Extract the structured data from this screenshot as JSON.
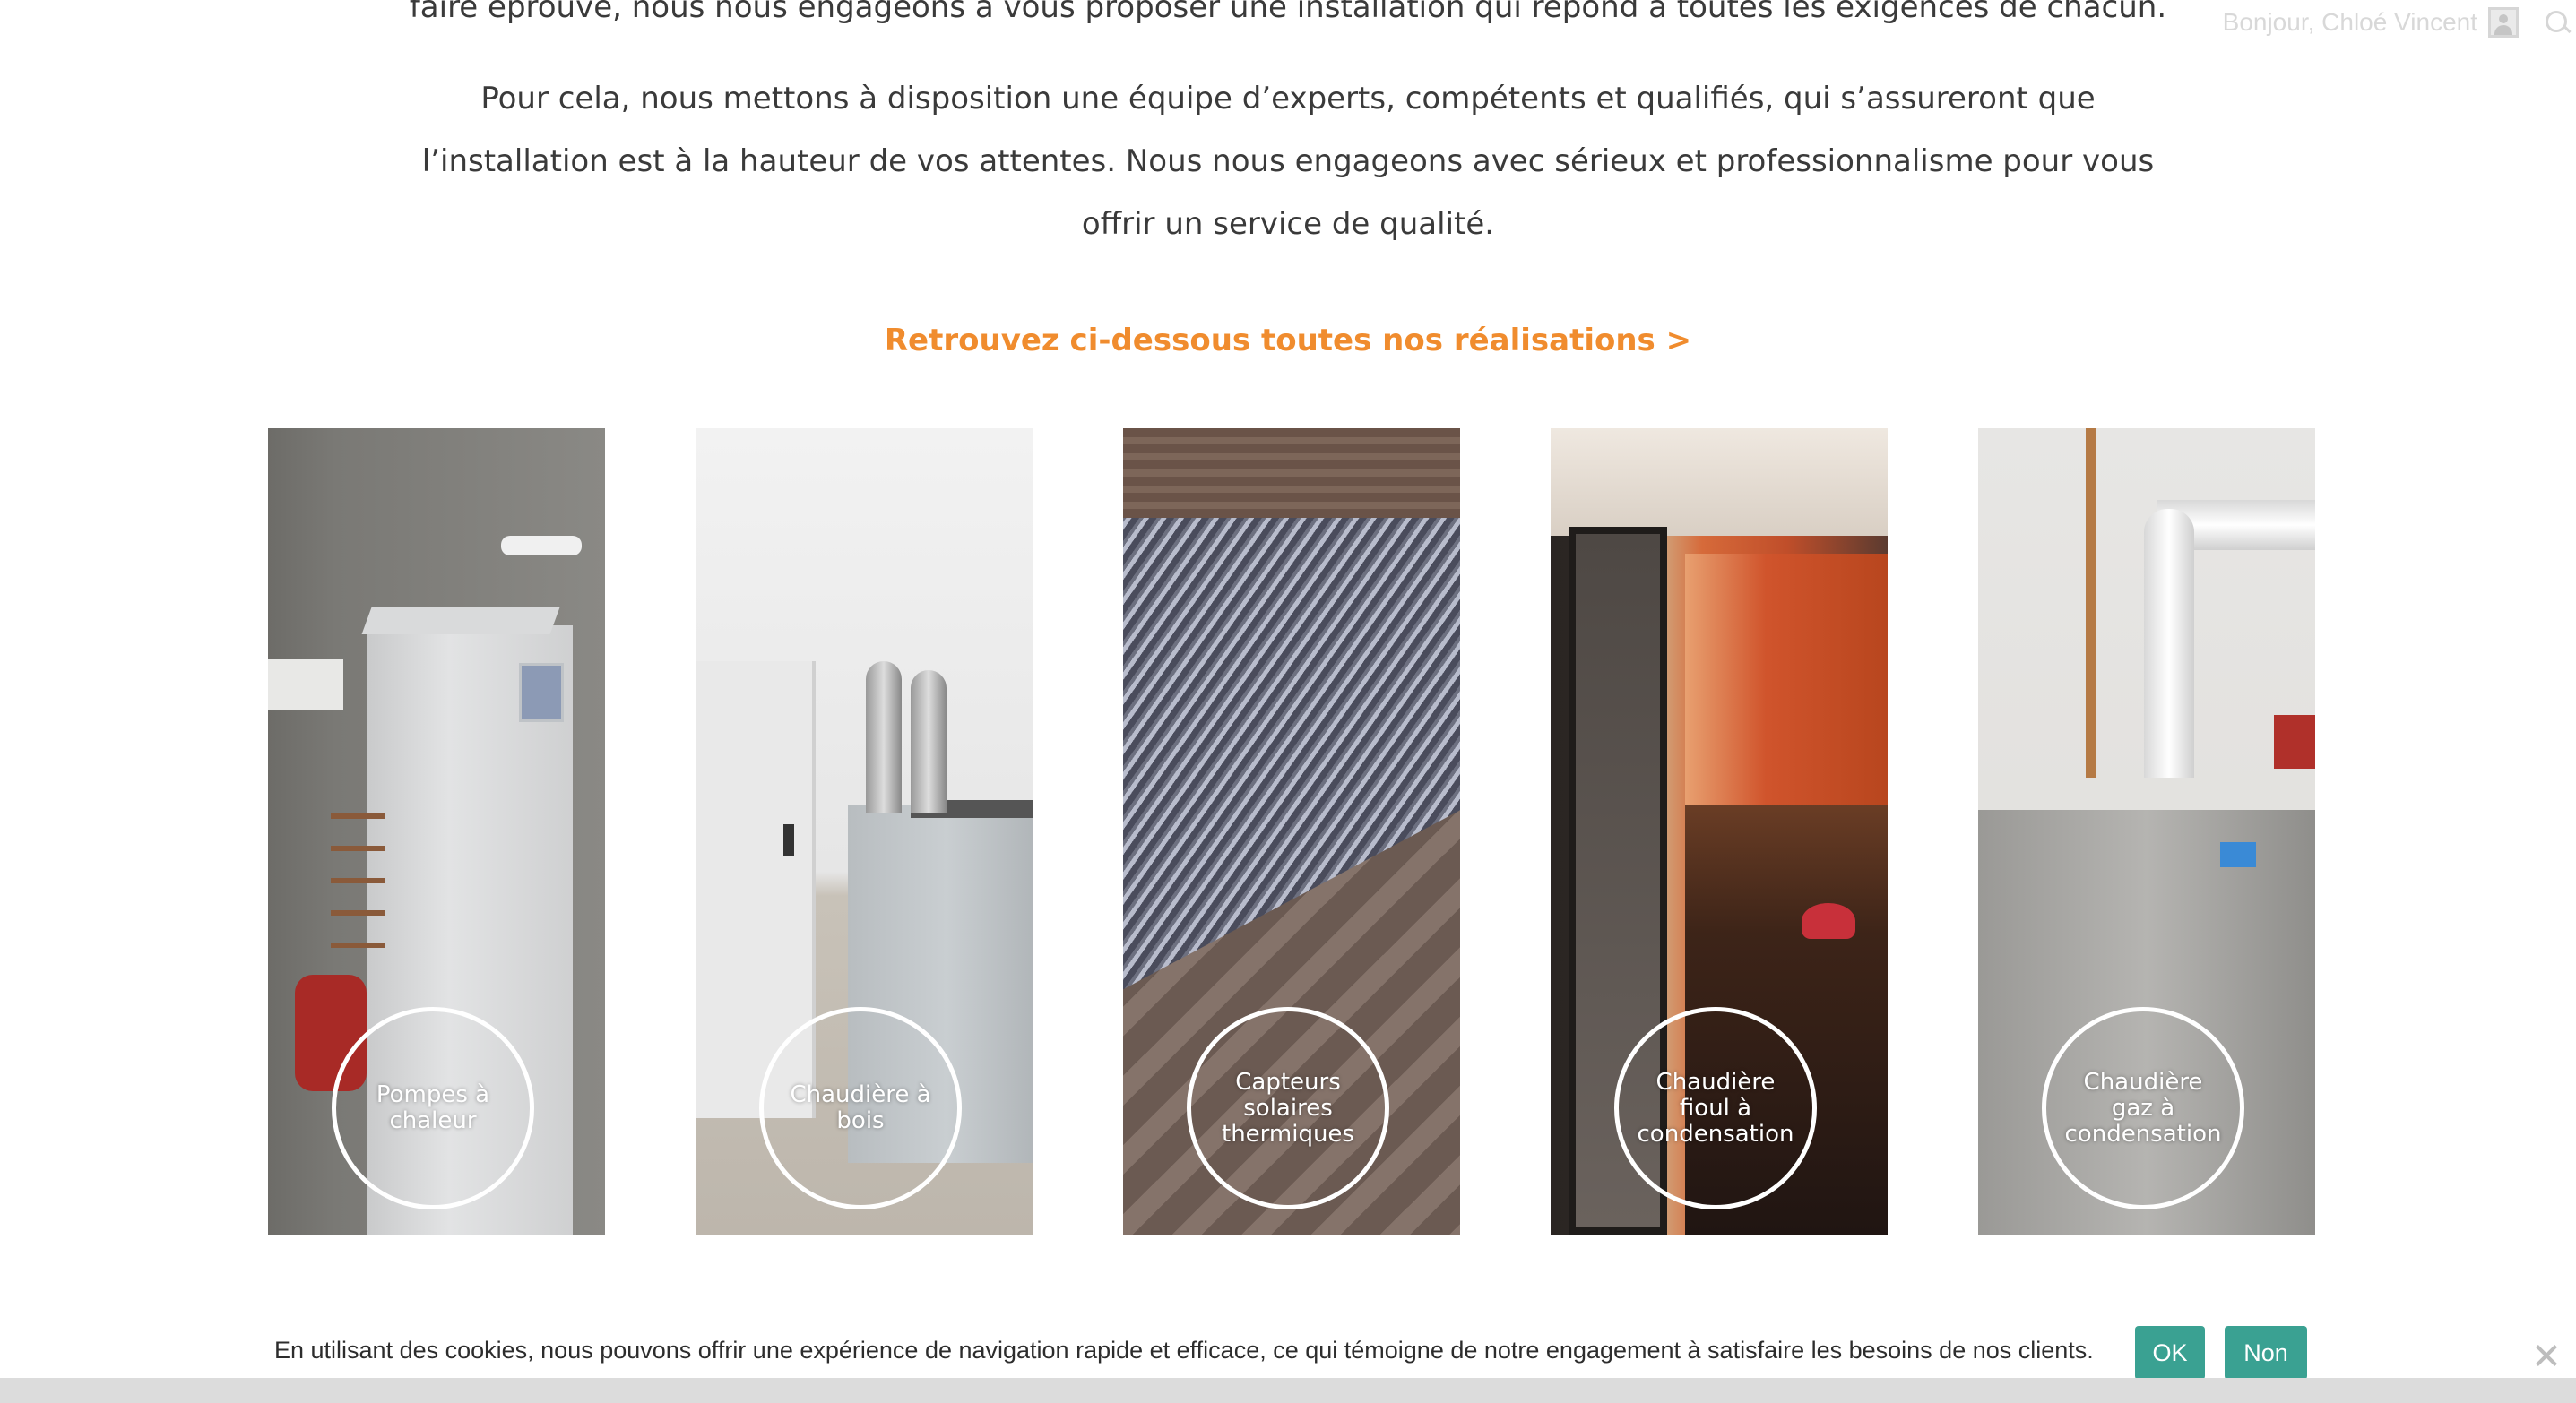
{
  "intro": {
    "line0": "faire éprouvé, nous nous engageons à vous proposer une installation qui répond à toutes les exigences de chacun.",
    "line1": "Pour cela, nous mettons à disposition une équipe d’experts, compétents et qualifiés, qui s’assureront que",
    "line2": "l’installation est à la hauteur de vos attentes. Nous nous engageons avec sérieux et professionnalisme pour vous",
    "line3": "offrir un service de qualité."
  },
  "cta": {
    "label": "Retrouvez ci-dessous toutes nos réalisations >",
    "color": "#f08c2e"
  },
  "user": {
    "greeting": "Bonjour, Chloé Vincent"
  },
  "cards": [
    {
      "label": "Pompes à chaleur"
    },
    {
      "label": "Chaudière à bois"
    },
    {
      "label": "Capteurs solaires thermiques"
    },
    {
      "label": "Chaudière fioul à condensation"
    },
    {
      "label": "Chaudière gaz à condensation"
    }
  ],
  "cookie": {
    "text": "En utilisant des cookies, nous pouvons offrir une expérience de navigation rapide et efficace, ce qui témoigne de notre engagement à satisfaire les besoins de nos clients.",
    "ok_label": "OK",
    "no_label": "Non",
    "button_color": "#3aa192"
  }
}
